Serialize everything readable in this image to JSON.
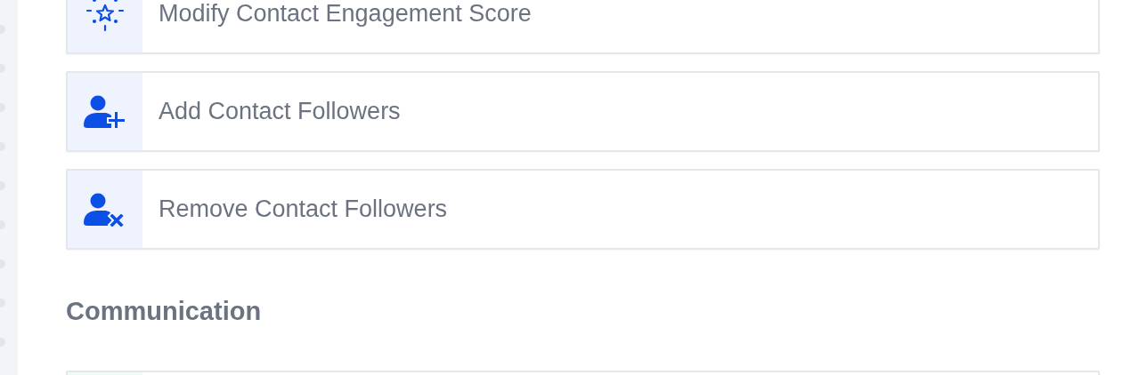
{
  "sections": [
    {
      "items": [
        {
          "kind": "star",
          "label": "Modify Contact Engagement Score",
          "color": "#eef3fe"
        },
        {
          "kind": "user-add",
          "label": "Add Contact Followers",
          "color": "#eef3fe"
        },
        {
          "kind": "user-remove",
          "label": "Remove Contact Followers",
          "color": "#eef3fe"
        }
      ]
    },
    {
      "heading": "Communication",
      "items": [
        {
          "kind": "blank",
          "color": "#ecfdf3"
        }
      ]
    }
  ]
}
